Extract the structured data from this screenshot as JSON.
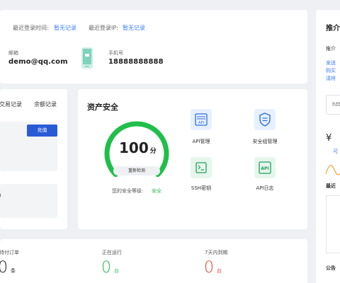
{
  "account": {
    "last_login_time_label": "最近登录时间:",
    "last_login_time_value": "暂无记录",
    "last_login_ip_label": "最近登录IP:",
    "last_login_ip_value": "暂无记录",
    "email_label": "邮箱",
    "email_value": "demo@qq.com",
    "phone_label": "手机号",
    "phone_value": "18888888888"
  },
  "balance": {
    "tab_transactions": "交易记录",
    "tab_balance": "余额记录",
    "recharge_button": "充值",
    "partial_text": ")"
  },
  "security": {
    "title": "资产安全",
    "score": "100",
    "score_unit": "分",
    "score_fraction": 1.0,
    "recheck_button": "重新检测",
    "level_label": "您的安全等级:",
    "level_value": "安全",
    "items": [
      {
        "label": "API管理",
        "icon_text": "API"
      },
      {
        "label": "安全组管理",
        "icon_text": ""
      },
      {
        "label": "SSH密钥",
        "icon_text": ">_"
      },
      {
        "label": "API日志",
        "icon_text": "API"
      }
    ]
  },
  "stats": [
    {
      "label": "待付订单",
      "value": "0",
      "unit": "条",
      "color": "#222222"
    },
    {
      "label": "正在运行",
      "value": "0",
      "unit": "台",
      "color": "#2db84d"
    },
    {
      "label": "7天内到期",
      "value": "0",
      "unit": "台",
      "color": "#e0483e"
    }
  ],
  "right_panel": {
    "title": "推介",
    "sub_title": "推介",
    "desc_line1": "发送",
    "desc_line2": "购买",
    "desc_line3": "请将",
    "input_partial": "htt",
    "currency_symbol": "¥",
    "can_withdraw_partial": "可",
    "recent_partial": "最近",
    "notice_partial": "公告"
  },
  "colors": {
    "accent": "#3d7eff",
    "gauge_green": "#1fbf4a",
    "safe_green": "#2db84d",
    "danger_red": "#e0483e"
  }
}
